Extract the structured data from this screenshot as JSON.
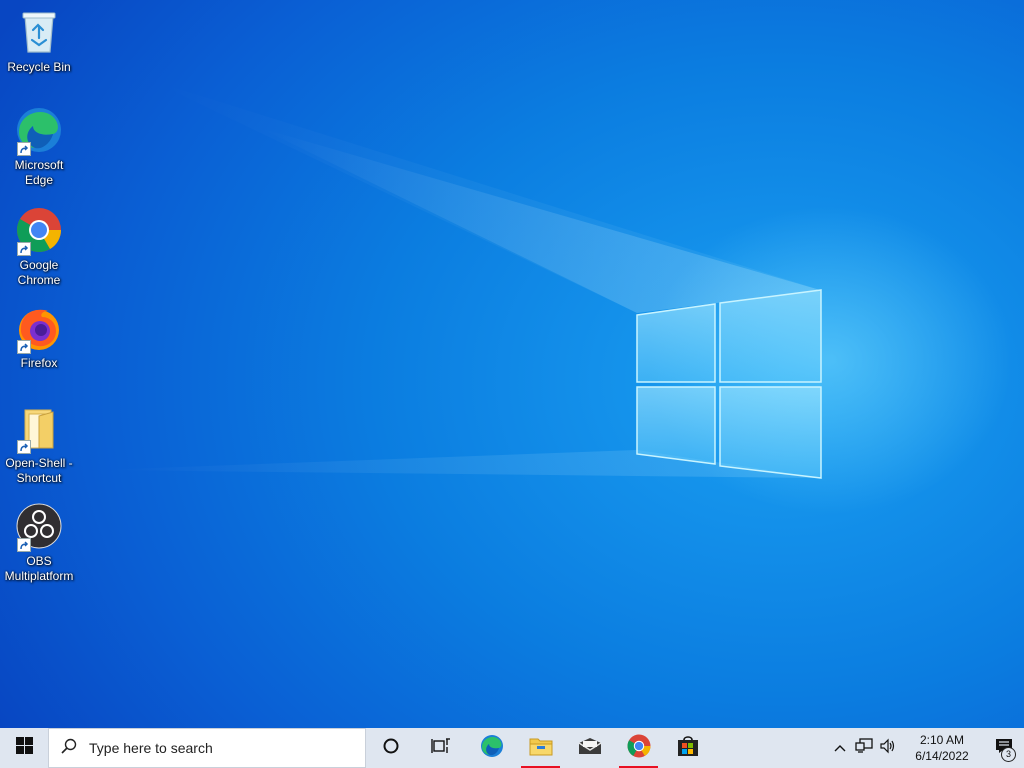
{
  "desktop": {
    "icons": [
      {
        "label": "Recycle Bin",
        "icon": "recycle-bin-icon",
        "shortcut": false
      },
      {
        "label": "Microsoft\nEdge",
        "icon": "edge-icon",
        "shortcut": true
      },
      {
        "label": "Google\nChrome",
        "icon": "chrome-icon",
        "shortcut": true
      },
      {
        "label": "Firefox",
        "icon": "firefox-icon",
        "shortcut": true
      },
      {
        "label": "Open-Shell -\nShortcut",
        "icon": "folder-icon",
        "shortcut": true
      },
      {
        "label": "OBS\nMultiplatform",
        "icon": "obs-icon",
        "shortcut": true
      }
    ]
  },
  "taskbar": {
    "search_placeholder": "Type here to search",
    "apps": [
      {
        "name": "Cortana",
        "icon": "cortana-circle-icon",
        "running": false
      },
      {
        "name": "Task View",
        "icon": "task-view-icon",
        "running": false
      },
      {
        "name": "Microsoft Edge",
        "icon": "edge-icon",
        "running": false
      },
      {
        "name": "File Explorer",
        "icon": "file-explorer-icon",
        "running": true
      },
      {
        "name": "Mail",
        "icon": "mail-icon",
        "running": false
      },
      {
        "name": "Google Chrome",
        "icon": "chrome-icon",
        "running": true
      },
      {
        "name": "Microsoft Store",
        "icon": "store-icon",
        "running": false
      }
    ],
    "tray": {
      "time": "2:10 AM",
      "date": "6/14/2022",
      "notification_count": "3"
    }
  },
  "colors": {
    "running_indicator": "#e81123",
    "taskbar_bg": "#dfe6f0"
  }
}
